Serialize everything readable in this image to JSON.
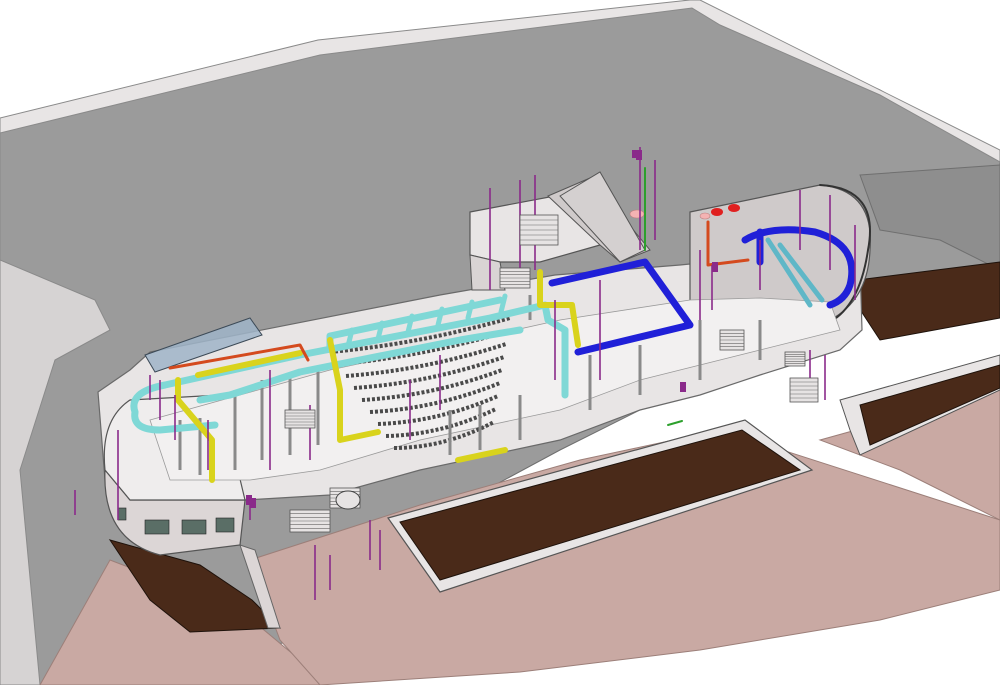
{
  "view": {
    "kind": "3D isometric BIM section model",
    "palette": {
      "background": "#ffffff",
      "site_terrain": "#9b9b9b",
      "site_edge": "#bdbdbd",
      "excavation_soil": "#4a2a19",
      "paving": "#c9a9a3",
      "concrete": "#e8e5e5",
      "concrete_shadow": "#cfcaca",
      "duct_supply": "#7fd8d6",
      "duct_exhaust": "#2020d8",
      "pipe_yellow": "#d9d31c",
      "pipe_red": "#d44a1e",
      "pipe_purple": "#8a2a8a",
      "fire_red": "#e02020",
      "glass": "#9fb4c8",
      "seating": "#4a4a4a",
      "marker_green": "#2ca02c"
    }
  }
}
